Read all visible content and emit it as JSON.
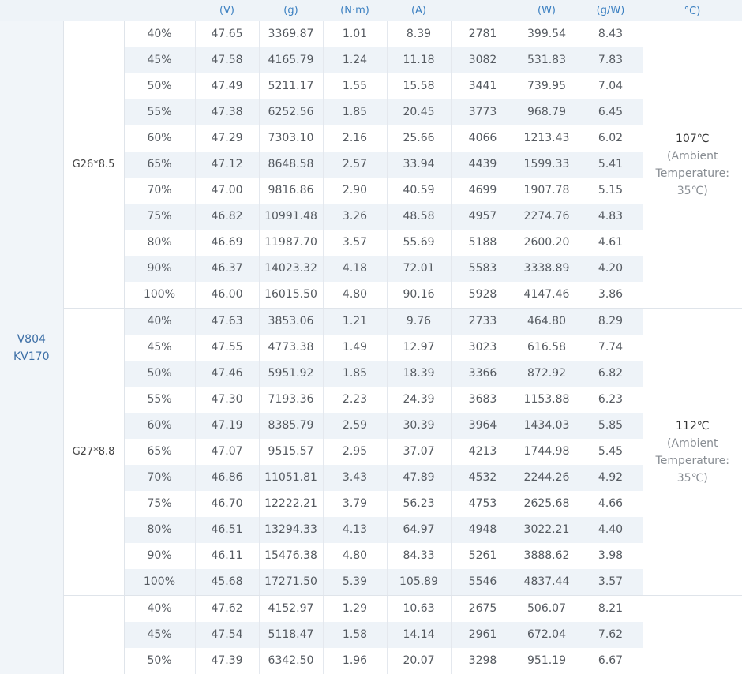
{
  "header": {
    "columns": [
      "(V)",
      "(g)",
      "(N·m)",
      "(A)",
      "",
      "(W)",
      "(g/W)",
      "°C)"
    ]
  },
  "model": {
    "line1": "V804",
    "line2": "KV170"
  },
  "blocks": [
    {
      "propeller": "G26*8.5",
      "temp_main": "107℃",
      "temp_note1": "(Ambient",
      "temp_note2": "Temperature:",
      "temp_note3": "35℃)",
      "rows": [
        [
          "40%",
          "47.65",
          "3369.87",
          "1.01",
          "8.39",
          "2781",
          "399.54",
          "8.43"
        ],
        [
          "45%",
          "47.58",
          "4165.79",
          "1.24",
          "11.18",
          "3082",
          "531.83",
          "7.83"
        ],
        [
          "50%",
          "47.49",
          "5211.17",
          "1.55",
          "15.58",
          "3441",
          "739.95",
          "7.04"
        ],
        [
          "55%",
          "47.38",
          "6252.56",
          "1.85",
          "20.45",
          "3773",
          "968.79",
          "6.45"
        ],
        [
          "60%",
          "47.29",
          "7303.10",
          "2.16",
          "25.66",
          "4066",
          "1213.43",
          "6.02"
        ],
        [
          "65%",
          "47.12",
          "8648.58",
          "2.57",
          "33.94",
          "4439",
          "1599.33",
          "5.41"
        ],
        [
          "70%",
          "47.00",
          "9816.86",
          "2.90",
          "40.59",
          "4699",
          "1907.78",
          "5.15"
        ],
        [
          "75%",
          "46.82",
          "10991.48",
          "3.26",
          "48.58",
          "4957",
          "2274.76",
          "4.83"
        ],
        [
          "80%",
          "46.69",
          "11987.70",
          "3.57",
          "55.69",
          "5188",
          "2600.20",
          "4.61"
        ],
        [
          "90%",
          "46.37",
          "14023.32",
          "4.18",
          "72.01",
          "5583",
          "3338.89",
          "4.20"
        ],
        [
          "100%",
          "46.00",
          "16015.50",
          "4.80",
          "90.16",
          "5928",
          "4147.46",
          "3.86"
        ]
      ]
    },
    {
      "propeller": "G27*8.8",
      "temp_main": "112℃",
      "temp_note1": "(Ambient",
      "temp_note2": "Temperature:",
      "temp_note3": "35℃)",
      "rows": [
        [
          "40%",
          "47.63",
          "3853.06",
          "1.21",
          "9.76",
          "2733",
          "464.80",
          "8.29"
        ],
        [
          "45%",
          "47.55",
          "4773.38",
          "1.49",
          "12.97",
          "3023",
          "616.58",
          "7.74"
        ],
        [
          "50%",
          "47.46",
          "5951.92",
          "1.85",
          "18.39",
          "3366",
          "872.92",
          "6.82"
        ],
        [
          "55%",
          "47.30",
          "7193.36",
          "2.23",
          "24.39",
          "3683",
          "1153.88",
          "6.23"
        ],
        [
          "60%",
          "47.19",
          "8385.79",
          "2.59",
          "30.39",
          "3964",
          "1434.03",
          "5.85"
        ],
        [
          "65%",
          "47.07",
          "9515.57",
          "2.95",
          "37.07",
          "4213",
          "1744.98",
          "5.45"
        ],
        [
          "70%",
          "46.86",
          "11051.81",
          "3.43",
          "47.89",
          "4532",
          "2244.26",
          "4.92"
        ],
        [
          "75%",
          "46.70",
          "12222.21",
          "3.79",
          "56.23",
          "4753",
          "2625.68",
          "4.66"
        ],
        [
          "80%",
          "46.51",
          "13294.33",
          "4.13",
          "64.97",
          "4948",
          "3022.21",
          "4.40"
        ],
        [
          "90%",
          "46.11",
          "15476.38",
          "4.80",
          "84.33",
          "5261",
          "3888.62",
          "3.98"
        ],
        [
          "100%",
          "45.68",
          "17271.50",
          "5.39",
          "105.89",
          "5546",
          "4837.44",
          "3.57"
        ]
      ]
    },
    {
      "propeller": "",
      "temp_main": "",
      "temp_note1": "",
      "temp_note2": "",
      "temp_note3": "",
      "rows": [
        [
          "40%",
          "47.62",
          "4152.97",
          "1.29",
          "10.63",
          "2675",
          "506.07",
          "8.21"
        ],
        [
          "45%",
          "47.54",
          "5118.47",
          "1.58",
          "14.14",
          "2961",
          "672.04",
          "7.62"
        ],
        [
          "50%",
          "47.39",
          "6342.50",
          "1.96",
          "20.07",
          "3298",
          "951.19",
          "6.67"
        ]
      ]
    }
  ]
}
